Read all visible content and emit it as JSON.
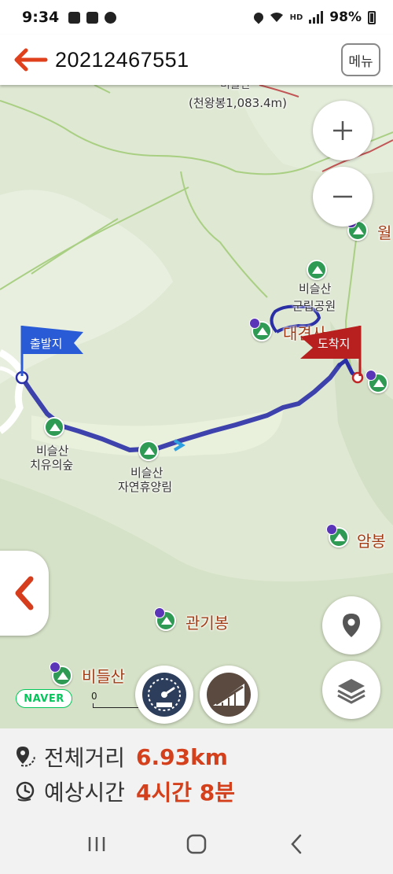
{
  "status_bar": {
    "time": "9:34",
    "battery": "98%",
    "hd_label": "HD"
  },
  "header": {
    "title": "20212467551",
    "menu_label": "메뉴"
  },
  "map": {
    "labels": {
      "top_name_partial": "비슬산",
      "top_peak": "(천왕봉1,083.4m)",
      "park_line1": "비슬산",
      "park_line2": "군립공원",
      "daegyeon": "대견사",
      "healing_line1": "비슬산",
      "healing_line2": "치유의숲",
      "forest_line1": "비슬산",
      "forest_line2": "자연휴양림",
      "wol": "월",
      "ambong": "암봉",
      "gwangibong": "관기봉",
      "bideulsan": "비들산"
    },
    "start_flag": "출발지",
    "end_flag": "도착지",
    "naver_logo": "NAVER",
    "scale_label": "0"
  },
  "info": {
    "distance_label": "전체거리",
    "distance_value": "6.93km",
    "time_label": "예상시간",
    "time_value": "4시간 8분"
  },
  "colors": {
    "accent": "#d4401c",
    "route": "#2b2fa6",
    "start_flag": "#2a5bd6",
    "end_flag": "#b8201f",
    "map_bg": "#dfe8d3"
  }
}
